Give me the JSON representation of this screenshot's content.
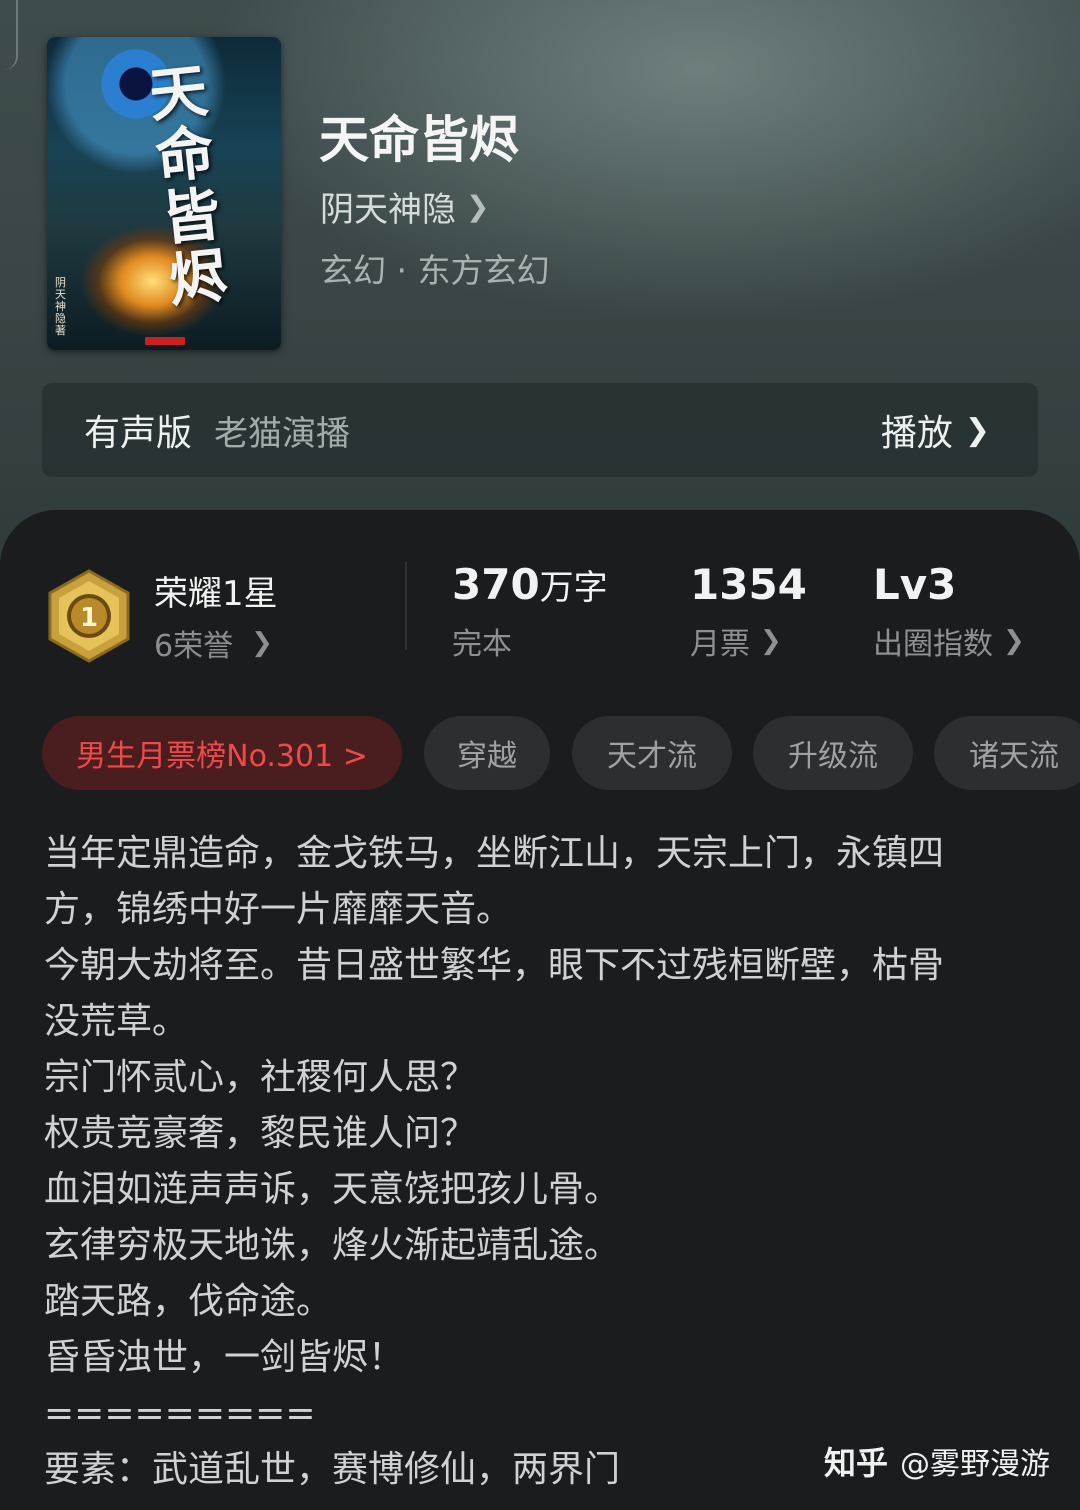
{
  "book": {
    "cover_title": "天命皆烬",
    "cover_author_vertical": "阴天神隐著",
    "title": "天命皆烬",
    "author": "阴天神隐",
    "genre": "玄幻 · 东方玄幻"
  },
  "audio": {
    "label": "有声版",
    "narrator": "老猫演播",
    "play_label": "播放"
  },
  "honor": {
    "medal_number": "1",
    "title": "荣耀1星",
    "subtitle": "6荣誉"
  },
  "stats": [
    {
      "value": "370",
      "unit": "万字",
      "label": "完本"
    },
    {
      "value": "1354",
      "unit": "",
      "label": "月票"
    },
    {
      "value": "Lv3",
      "unit": "",
      "label": "出圈指数"
    }
  ],
  "tags": [
    "男生月票榜No.301 >",
    "穿越",
    "天才流",
    "升级流",
    "诸天流"
  ],
  "description": [
    "当年定鼎造命，金戈铁马，坐断江山，天宗上门，永镇四",
    "方，锦绣中好一片靡靡天音。",
    "今朝大劫将至。昔日盛世繁华，眼下不过残桓断壁，枯骨",
    "没荒草。",
    "宗门怀贰心，社稷何人思？",
    "权贵竞豪奢，黎民谁人问？",
    "血泪如涟声声诉，天意饶把孩儿骨。",
    "玄律穷极天地诛，烽火渐起靖乱途。",
    "踏天路，伐命途。",
    "昏昏浊世，一剑皆烬！",
    "=========",
    "要素：武道乱世，赛博修仙，两界门"
  ],
  "watermark": {
    "site": "知乎",
    "user": "@雾野漫游"
  },
  "colors": {
    "background": "#1a1c1d",
    "rank_tag_text": "#ee4a4a",
    "rank_tag_bg": "#4a1d1f"
  }
}
